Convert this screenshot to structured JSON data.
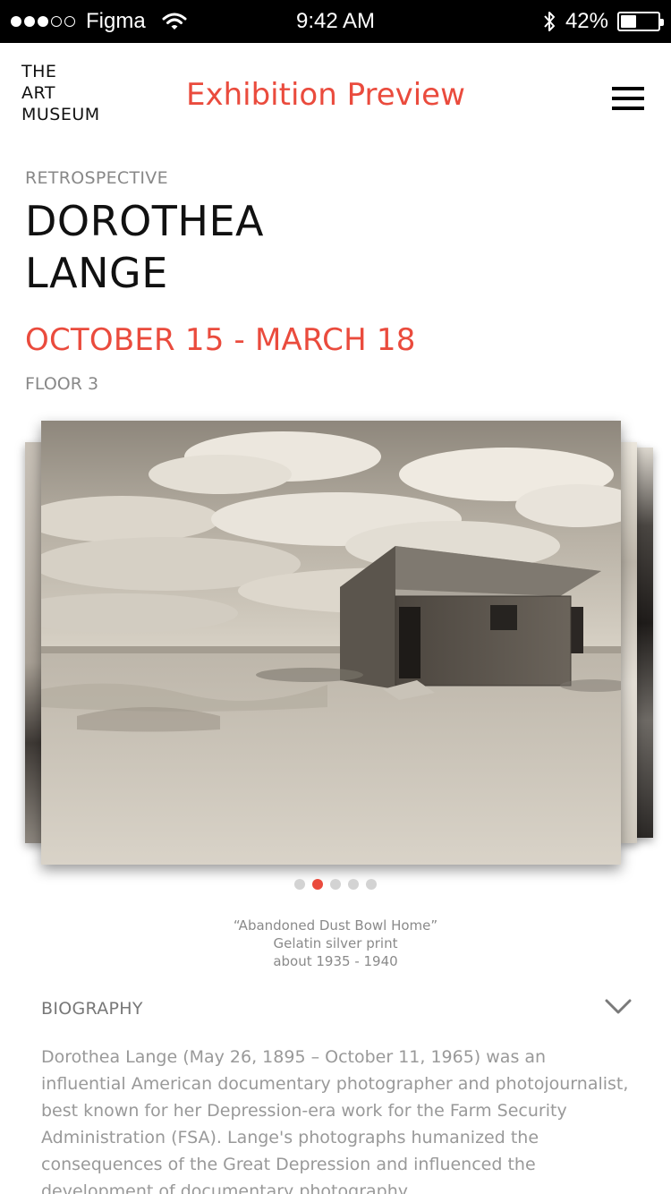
{
  "status_bar": {
    "carrier": "Figma",
    "time": "9:42 AM",
    "battery": "42%",
    "battery_level": 0.42
  },
  "header": {
    "logo_lines": [
      "THE",
      "ART",
      "MUSEUM"
    ],
    "title": "Exhibition Preview",
    "menu_icon": "hamburger-menu-icon"
  },
  "exhibition": {
    "kicker": "RETROSPECTIVE",
    "title_lines": [
      "DOROTHEA",
      "LANGE"
    ],
    "dates": "OCTOBER 15 - MARCH 18",
    "floor": "FLOOR 3"
  },
  "carousel": {
    "page_count": 5,
    "active_index": 1,
    "caption": {
      "title": "“Abandoned Dust Bowl Home”",
      "medium": "Gelatin silver print",
      "date": "about 1935 - 1940"
    }
  },
  "biography": {
    "title": "BIOGRAPHY",
    "text": "Dorothea Lange (May 26, 1895 – October 11, 1965) was an influential American documentary photographer and photojournalist, best known for her Depression-era work for the Farm Security Administration (FSA). Lange's photographs humanized the consequences of the Great Depression and influenced the development of documentary photography."
  },
  "colors": {
    "accent": "#ea4b3d",
    "muted_text": "#888888",
    "pager_inactive": "#d3d3d3"
  }
}
